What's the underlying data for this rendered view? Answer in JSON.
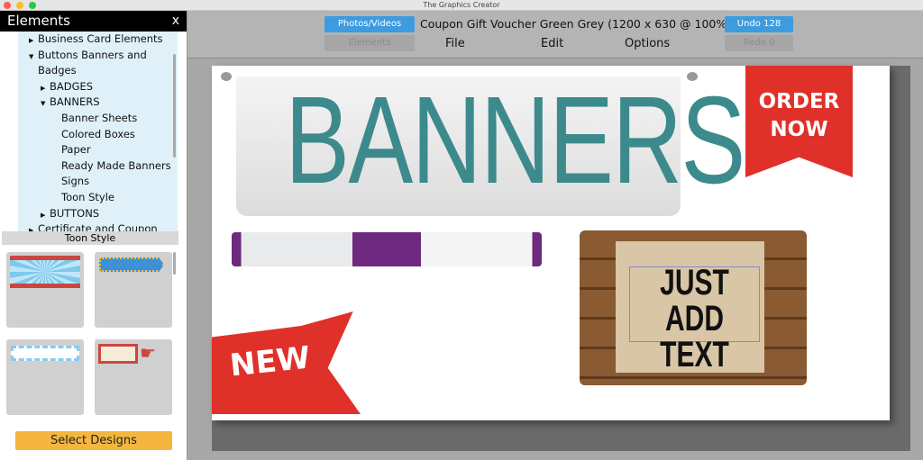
{
  "window": {
    "title": "The Graphics Creator"
  },
  "sidebar": {
    "title": "Elements",
    "close": "x",
    "tree": [
      {
        "label": "Business Card Elements",
        "level": 0,
        "state": "collapsed"
      },
      {
        "label": "Buttons Banners and",
        "level": 0,
        "state": "expanded"
      },
      {
        "label": "Badges",
        "level": 0,
        "state": "none"
      },
      {
        "label": "BADGES",
        "level": 1,
        "state": "collapsed"
      },
      {
        "label": "BANNERS",
        "level": 1,
        "state": "expanded"
      },
      {
        "label": "Banner Sheets",
        "level": 2,
        "state": "none"
      },
      {
        "label": "Colored Boxes",
        "level": 2,
        "state": "none"
      },
      {
        "label": "Paper",
        "level": 2,
        "state": "none"
      },
      {
        "label": "Ready Made Banners",
        "level": 2,
        "state": "none"
      },
      {
        "label": "Signs",
        "level": 2,
        "state": "none"
      },
      {
        "label": "Toon Style",
        "level": 2,
        "state": "none"
      },
      {
        "label": "BUTTONS",
        "level": 1,
        "state": "collapsed"
      },
      {
        "label": "Certificate and Coupon",
        "level": 0,
        "state": "collapsed"
      }
    ],
    "section_title": "Toon Style",
    "select_designs": "Select Designs"
  },
  "toolbar": {
    "photos_videos": "Photos/Videos",
    "elements": "Elements",
    "document_title": "Coupon Gift Voucher Green Grey (1200 x 630 @ 100%)",
    "menus": [
      "File",
      "Edit",
      "Options"
    ],
    "undo": "Undo 128",
    "redo": "Redo 0"
  },
  "canvas": {
    "banner_text": "BANNERS",
    "order_now": [
      "ORDER",
      "NOW"
    ],
    "new_text": "NEW",
    "sign_text": [
      "JUST",
      "ADD TEXT"
    ],
    "colors": {
      "teal": "#3c8a8c",
      "red": "#e0302a",
      "purple": "#6e2a7e",
      "wood": "#8a5a32"
    }
  }
}
